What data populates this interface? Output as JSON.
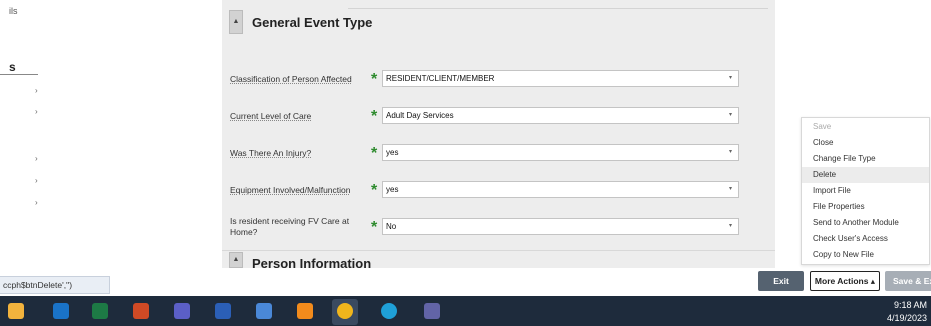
{
  "sidebar": {
    "top_text": "ils",
    "heading": "s",
    "arrow_glyph": "›"
  },
  "section_general": {
    "toggle_glyph": "▲",
    "title": "General Event Type"
  },
  "fields": [
    {
      "label": "Classification of Person Affected",
      "value": "RESIDENT/CLIENT/MEMBER"
    },
    {
      "label": "Current Level of Care",
      "value": "Adult Day Services"
    },
    {
      "label": "Was There An Injury?",
      "value": "yes"
    },
    {
      "label": "Equipment Involved/Malfunction",
      "value": "yes"
    },
    {
      "label": "Is resident receiving FV Care at Home?",
      "value": "No"
    }
  ],
  "required_glyph": "*",
  "caret_glyph": "▾",
  "section_person": {
    "toggle_glyph": "▲",
    "title": "Person Information"
  },
  "menu": {
    "items": [
      "Save",
      "Close",
      "Change File Type",
      "Delete",
      "Import File",
      "File Properties",
      "Send to Another Module",
      "Check User's Access",
      "Copy to New File"
    ]
  },
  "status_url": "ccph$btnDelete','')",
  "buttons": {
    "exit": "Exit",
    "more_actions": "More Actions ▴",
    "save_exit": "Save & Exit"
  },
  "taskbar": {
    "time": "9:18 AM",
    "date": "4/19/2023",
    "icons": [
      "file-explorer-icon",
      "outlook-icon",
      "excel-icon",
      "powerpoint-icon",
      "teams-icon",
      "word-icon",
      "network-icon",
      "app-icon",
      "chrome-icon",
      "edge-icon",
      "teams-chat-icon"
    ],
    "colors": {
      "file-explorer-icon": "#f2b33d",
      "outlook-icon": "#1a73c8",
      "excel-icon": "#1d7a45",
      "powerpoint-icon": "#d04a25",
      "teams-icon": "#5b5fc7",
      "word-icon": "#2b5fb7",
      "network-icon": "#4a88d8",
      "app-icon": "#f28b1c",
      "chrome-icon": "#f0b51c",
      "edge-icon": "#1fa0d8",
      "teams-chat-icon": "#6264a7"
    }
  }
}
